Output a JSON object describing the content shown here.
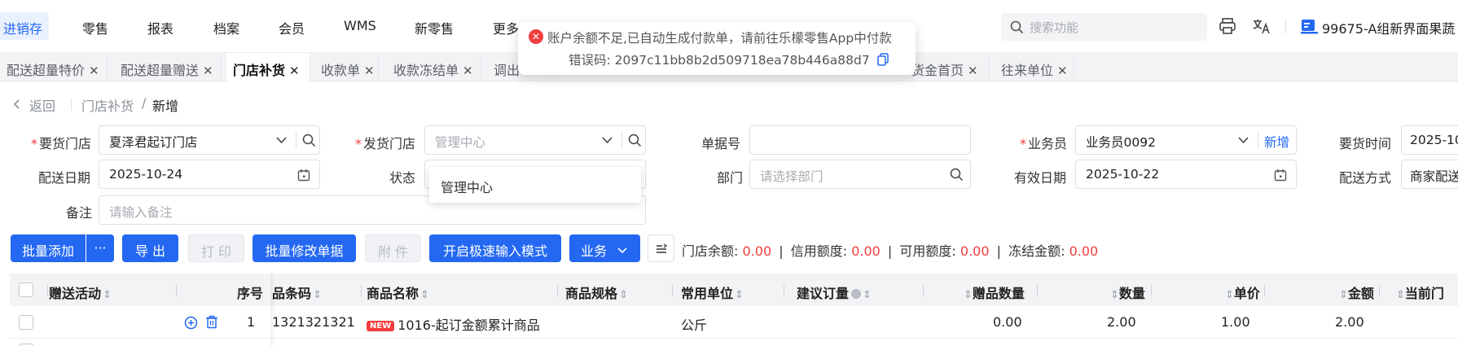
{
  "nav": {
    "items": [
      "进销存",
      "零售",
      "报表",
      "档案",
      "会员",
      "WMS",
      "新零售",
      "更多"
    ],
    "search_placeholder": "搜索功能",
    "store_name": "99675-A组新界面果蔬"
  },
  "tabs": [
    {
      "label": "配送超量特价",
      "active": false
    },
    {
      "label": "配送超量赠送",
      "active": false
    },
    {
      "label": "门店补货",
      "active": true
    },
    {
      "label": "收款单",
      "active": false
    },
    {
      "label": "收款冻结单",
      "active": false
    },
    {
      "label": "调出",
      "active": false
    },
    {
      "label": "货金首页",
      "active": false
    },
    {
      "label": "往来单位",
      "active": false
    }
  ],
  "toast": {
    "message": "账户余额不足,已自动生成付款单，请前往乐檬零售App中付款",
    "error_code": "错误码: 2097c11bb8b2d509718ea78b446a88d7"
  },
  "breadcrumb": {
    "back": "返回",
    "parent": "门店补货",
    "separator": "/",
    "current": "新增"
  },
  "form": {
    "request_store_label": "要货门店",
    "request_store_value": "夏泽君起订门店",
    "ship_store_label": "发货门店",
    "ship_store_placeholder": "管理中心",
    "doc_no_label": "单据号",
    "salesman_label": "业务员",
    "salesman_value": "业务员0092",
    "salesman_add": "新增",
    "request_time_label": "要货时间",
    "request_time_value": "2025-10",
    "delivery_date_label": "配送日期",
    "delivery_date_value": "2025-10-24",
    "status_label": "状态",
    "dept_label": "部门",
    "dept_placeholder": "请选择部门",
    "valid_date_label": "有效日期",
    "valid_date_value": "2025-10-22",
    "delivery_mode_label": "配送方式",
    "delivery_mode_value": "商家配送",
    "remark_label": "备注",
    "remark_placeholder": "请输入备注",
    "dropdown_option": "管理中心"
  },
  "toolbar": {
    "batch_add": "批量添加",
    "more": "···",
    "export": "导 出",
    "print": "打 印",
    "batch_edit": "批量修改单据",
    "attachment": "附 件",
    "fast_input": "开启极速输入模式",
    "business": "业务"
  },
  "summary": {
    "store_balance_label": "门店余额:",
    "store_balance": "0.00",
    "credit_label": "信用额度:",
    "credit": "0.00",
    "available_label": "可用额度:",
    "available": "0.00",
    "frozen_label": "冻结金额:",
    "frozen": "0.00",
    "sep": "|"
  },
  "table": {
    "headers": {
      "gift_activity": "赠送活动",
      "seq": "序号",
      "barcode": "品条码",
      "name": "商品名称",
      "spec": "商品规格",
      "unit": "常用单位",
      "suggest_qty": "建议订量",
      "gift_qty": "赠品数量",
      "qty": "数量",
      "price": "单价",
      "amount": "金额",
      "current": "当前门"
    },
    "rows": [
      {
        "seq": "1",
        "barcode": "1321321321",
        "badge": "NEW",
        "name": "1016-起订金额累计商品",
        "spec": "",
        "unit": "公斤",
        "gift_qty": "0.00",
        "qty": "2.00",
        "price": "1.00",
        "amount": "2.00"
      }
    ]
  },
  "colors": {
    "primary": "#2468f2",
    "danger": "#f23c3c"
  }
}
